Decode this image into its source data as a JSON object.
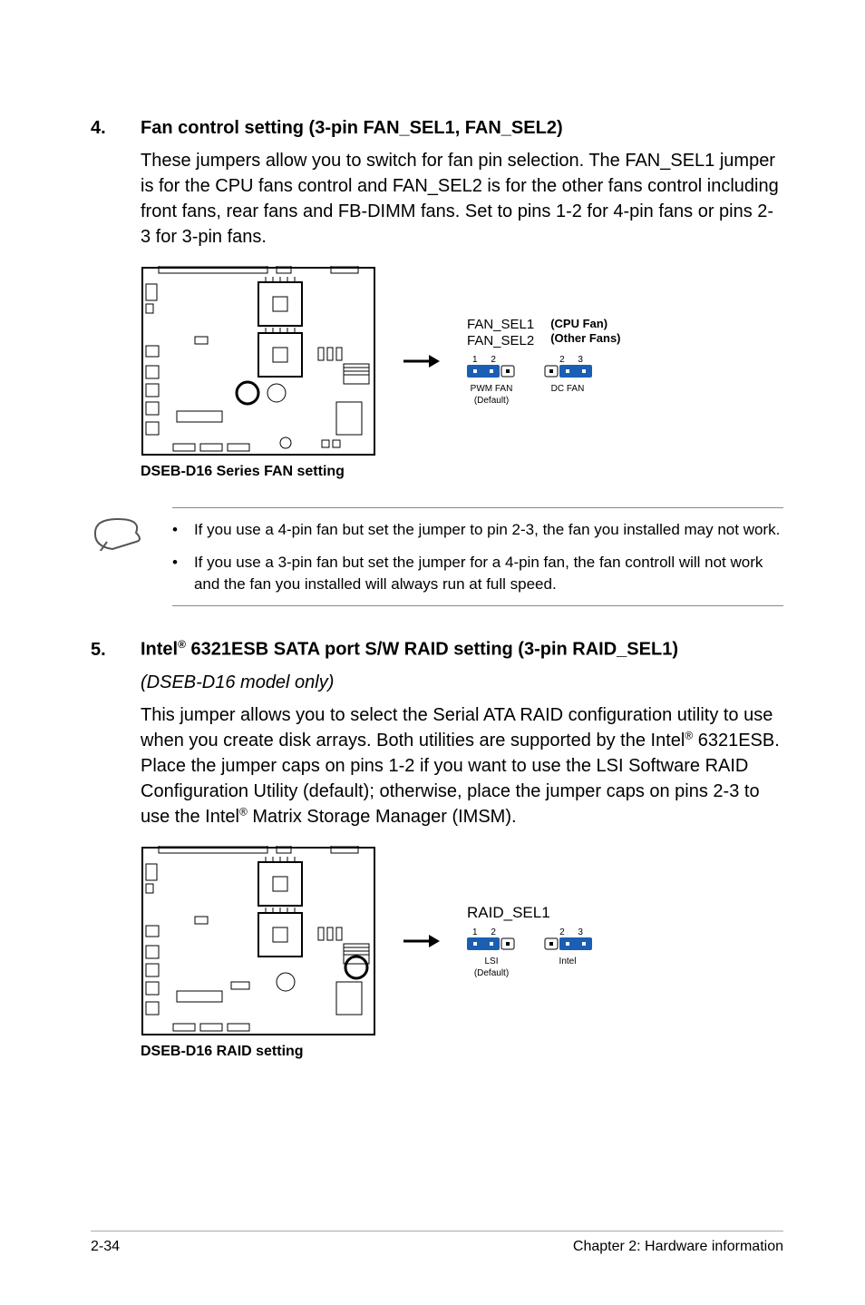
{
  "section4": {
    "num": "4.",
    "heading": "Fan control setting (3-pin FAN_SEL1, FAN_SEL2)",
    "body": "These jumpers allow you to switch for fan pin selection. The FAN_SEL1 jumper is for the CPU fans control and FAN_SEL2 is for the other fans control including front fans, rear fans and FB-DIMM fans. Set to pins 1-2 for 4-pin fans or pins 2-3 for 3-pin fans.",
    "diagram": {
      "label1": "FAN_SEL1",
      "label2": "FAN_SEL2",
      "right1": "(CPU Fan)",
      "right2": "(Other Fans)",
      "pins_left_nums": "1 2",
      "pins_right_nums": "2 3",
      "cap_left_1": "PWM FAN",
      "cap_left_2": "(Default)",
      "cap_right": "DC FAN",
      "caption": "DSEB-D16 Series FAN setting"
    }
  },
  "notes": {
    "item1": "If you use a 4-pin fan but set the jumper to pin 2-3, the fan you installed may not work.",
    "item2": "If you use a 3-pin fan but set the jumper for a 4-pin fan, the fan controll will not work and the fan you installed will always run at full speed."
  },
  "section5": {
    "num": "5.",
    "heading_pre": "Intel",
    "heading_post": " 6321ESB SATA port S/W RAID setting (3-pin RAID_SEL1)",
    "subtitle": "(DSEB-D16 model only)",
    "body_pre": "This jumper allows you to select the Serial ATA RAID configuration utility to use when you create disk arrays. Both utilities are supported by the Intel",
    "body_mid": " 6321ESB. Place the jumper caps on pins 1-2 if you want to use the LSI Software RAID Configuration Utility (default); otherwise, place the jumper caps on pins 2-3 to use the Intel",
    "body_post": " Matrix Storage Manager (IMSM).",
    "diagram": {
      "label": "RAID_SEL1",
      "pins_left_nums": "1 2",
      "pins_right_nums": "2 3",
      "cap_left_1": "LSI",
      "cap_left_2": "(Default)",
      "cap_right": "Intel",
      "caption": "DSEB-D16 RAID setting"
    }
  },
  "footer": {
    "left": "2-34",
    "right": "Chapter 2: Hardware information"
  }
}
